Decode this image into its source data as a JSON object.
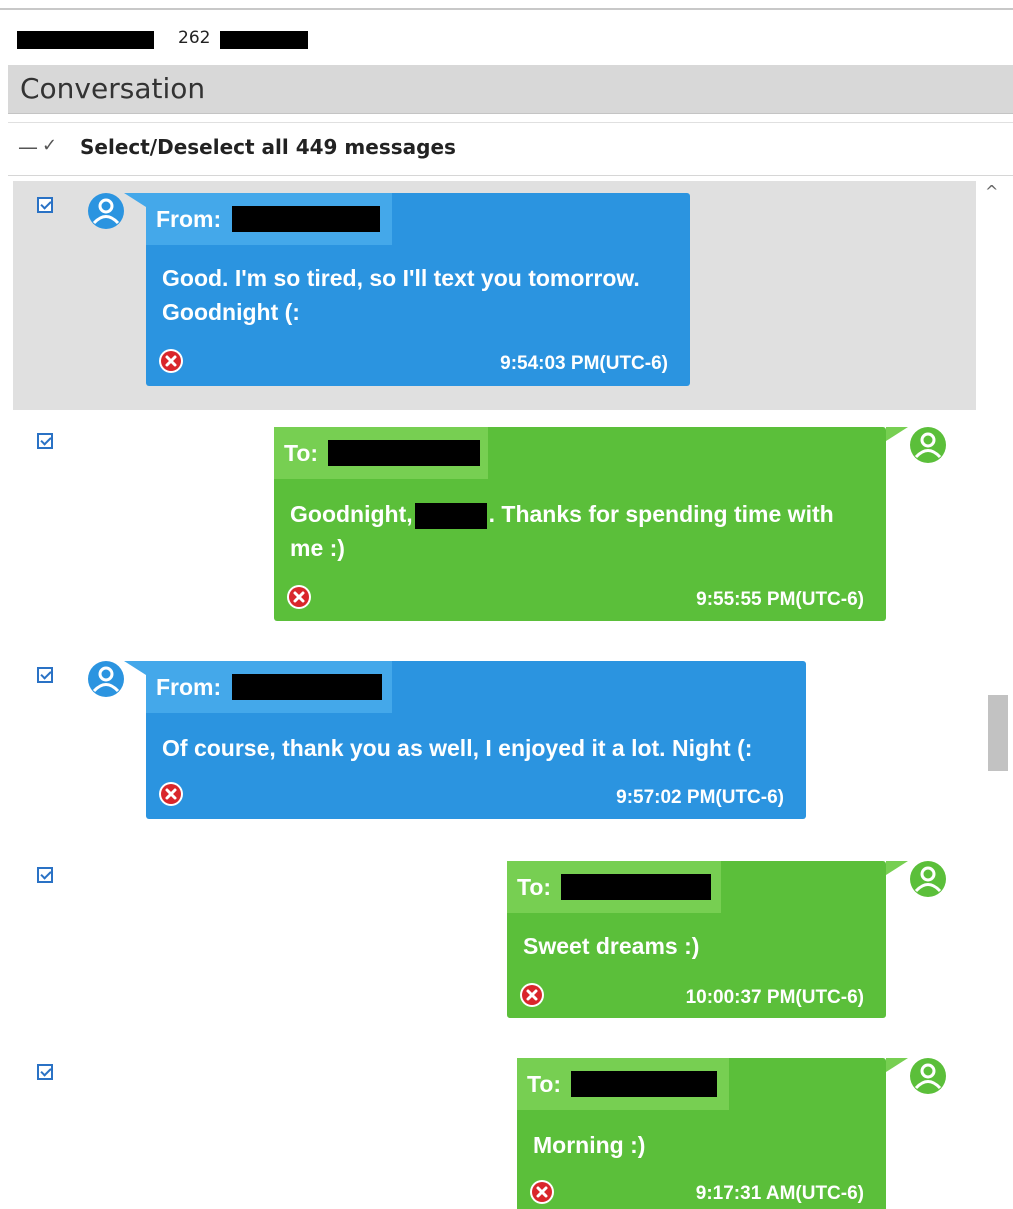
{
  "top": {
    "number": "262"
  },
  "header": {
    "title": "Conversation"
  },
  "select_all": {
    "label": "Select/Deselect all 449 messages"
  },
  "messages": [
    {
      "direction": "from",
      "header_label": "From:",
      "lines": [
        "Good. I'm so tired, so I'll text you tomorrow.",
        "Goodnight (:"
      ],
      "time": "9:54:03 PM(UTC-6)",
      "checked": true
    },
    {
      "direction": "to",
      "header_label": "To:",
      "lines": [
        "Goodnight,",
        ". Thanks for spending time with",
        "me :)"
      ],
      "time": "9:55:55 PM(UTC-6)",
      "checked": true
    },
    {
      "direction": "from",
      "header_label": "From:",
      "lines": [
        "Of course, thank you as well, I enjoyed it a lot. Night (:"
      ],
      "time": "9:57:02 PM(UTC-6)",
      "checked": true
    },
    {
      "direction": "to",
      "header_label": "To:",
      "lines": [
        "Sweet dreams :)"
      ],
      "time": "10:00:37 PM(UTC-6)",
      "checked": true
    },
    {
      "direction": "to",
      "header_label": "To:",
      "lines": [
        "Morning :)"
      ],
      "time": "9:17:31 AM(UTC-6)",
      "checked": true
    }
  ],
  "colors": {
    "from_bubble": "#2b94e0",
    "from_header": "#44a8ea",
    "to_bubble": "#5bbf3a",
    "to_header": "#77cf52",
    "checkbox": "#2a72c5",
    "failed_icon": "#d9262b"
  },
  "icons": {
    "contact": "person-circle-icon",
    "status": "failed-x-icon",
    "scroll": "chevron-up-icon"
  }
}
